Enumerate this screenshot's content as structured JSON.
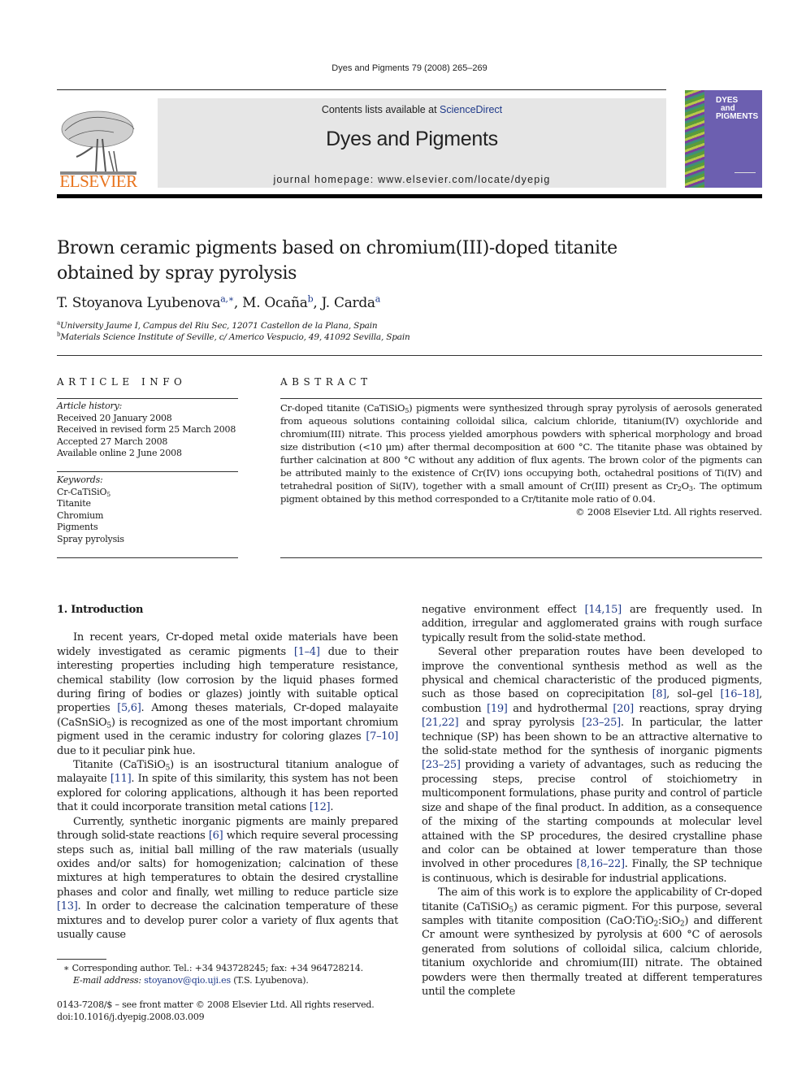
{
  "header": {
    "running_head": "Dyes and Pigments 79 (2008) 265–269",
    "contents_prefix": "Contents lists available at ",
    "contents_link": "ScienceDirect",
    "journal_title": "Dyes and Pigments",
    "homepage": "journal homepage: www.elsevier.com/locate/dyepig",
    "publisher_logo_text": "ELSEVIER",
    "cover_title": [
      "DYES",
      "and",
      "PIGMENTS"
    ],
    "colors": {
      "elsevier_orange": "#e8731c",
      "link_blue": "#1f3a8a",
      "header_box": "#e6e6e6",
      "cover_purple": "#6c5fb0"
    }
  },
  "article": {
    "title_line1": "Brown ceramic pigments based on chromium(III)-doped titanite",
    "title_line2": "obtained by spray pyrolysis",
    "authors": [
      {
        "name": "T. Stoyanova Lyubenova",
        "sup": "a,∗"
      },
      {
        "name": "M. Ocaña",
        "sup": "b"
      },
      {
        "name": "J. Carda",
        "sup": "a"
      }
    ],
    "affiliations": [
      {
        "mark": "a",
        "text": "University Jaume I, Campus del Riu Sec, 12071 Castellon de la Plana, Spain"
      },
      {
        "mark": "b",
        "text": "Materials Science Institute of Seville, c/ Americo Vespucio, 49, 41092 Sevilla, Spain"
      }
    ]
  },
  "article_info": {
    "heading": "ARTICLE INFO",
    "history_label": "Article history:",
    "history": [
      "Received 20 January 2008",
      "Received in revised form 25 March 2008",
      "Accepted 27 March 2008",
      "Available online 2 June 2008"
    ],
    "keywords_label": "Keywords:",
    "keywords": [
      "Cr-CaTiSiO5",
      "Titanite",
      "Chromium",
      "Pigments",
      "Spray pyrolysis"
    ]
  },
  "abstract": {
    "heading": "ABSTRACT",
    "text": "Cr-doped titanite (CaTiSiO5) pigments were synthesized through spray pyrolysis of aerosols generated from aqueous solutions containing colloidal silica, calcium chloride, titanium(IV) oxychloride and chromium(III) nitrate. This process yielded amorphous powders with spherical morphology and broad size distribution (<10 μm) after thermal decomposition at 600 °C. The titanite phase was obtained by further calcination at 800 °C without any addition of flux agents. The brown color of the pigments can be attributed mainly to the existence of Cr(IV) ions occupying both, octahedral positions of Ti(IV) and tetrahedral position of Si(IV), together with a small amount of Cr(III) present as Cr2O3. The optimum pigment obtained by this method corresponded to a Cr/titanite mole ratio of 0.04.",
    "copyright": "© 2008 Elsevier Ltd. All rights reserved."
  },
  "body": {
    "section_heading": "1.  Introduction",
    "left_paragraphs": [
      "In recent years, Cr-doped metal oxide materials have been widely investigated as ceramic pigments [1–4] due to their interesting properties including high temperature resistance, chemical stability (low corrosion by the liquid phases formed during firing of bodies or glazes) jointly with suitable optical properties [5,6]. Among theses materials, Cr-doped malayaite (CaSnSiO5) is recognized as one of the most important chromium pigment used in the ceramic industry for coloring glazes [7–10] due to it peculiar pink hue.",
      "Titanite (CaTiSiO5) is an isostructural titanium analogue of malayaite [11]. In spite of this similarity, this system has not been explored for coloring applications, although it has been reported that it could incorporate transition metal cations [12].",
      "Currently, synthetic inorganic pigments are mainly prepared through solid-state reactions [6] which require several processing steps such as, initial ball milling of the raw materials (usually oxides and/or salts) for homogenization; calcination of these mixtures at high temperatures to obtain the desired crystalline phases and color and finally, wet milling to reduce particle size [13]. In order to decrease the calcination temperature of these mixtures and to develop purer color a variety of flux agents that usually cause"
    ],
    "right_paragraphs": [
      "negative environment effect [14,15] are frequently used. In addition, irregular and agglomerated grains with rough surface typically result from the solid-state method.",
      "Several other preparation routes have been developed to improve the conventional synthesis method as well as the physical and chemical characteristic of the produced pigments, such as those based on coprecipitation [8], sol–gel [16–18], combustion [19] and hydrothermal [20] reactions, spray drying [21,22] and spray pyrolysis [23–25]. In particular, the latter technique (SP) has been shown to be an attractive alternative to the solid-state method for the synthesis of inorganic pigments [23–25] providing a variety of advantages, such as reducing the processing steps, precise control of stoichiometry in multicomponent formulations, phase purity and control of particle size and shape of the final product. In addition, as a consequence of the mixing of the starting compounds at molecular level attained with the SP procedures, the desired crystalline phase and color can be obtained at lower temperature than those involved in other procedures [8,16–22]. Finally, the SP technique is continuous, which is desirable for industrial applications.",
      "The aim of this work is to explore the applicability of Cr-doped titanite (CaTiSiO5) as ceramic pigment. For this purpose, several samples with titanite composition (CaO:TiO2:SiO2) and different Cr amount were synthesized by pyrolysis at 600 °C of aerosols generated from solutions of colloidal silica, calcium chloride, titanium oxychloride and chromium(III) nitrate. The obtained powders were then thermally treated at different temperatures until the complete"
    ]
  },
  "footnote": {
    "line1": "∗  Corresponding author. Tel.: +34 943728245; fax: +34 964728214.",
    "email_label": "E-mail address: ",
    "email": "stoyanov@qio.uji.es",
    "email_suffix": " (T.S. Lyubenova)."
  },
  "front_matter": {
    "issn_line": "0143-7208/$ – see front matter © 2008 Elsevier Ltd. All rights reserved.",
    "doi": "doi:10.1016/j.dyepig.2008.03.009"
  }
}
